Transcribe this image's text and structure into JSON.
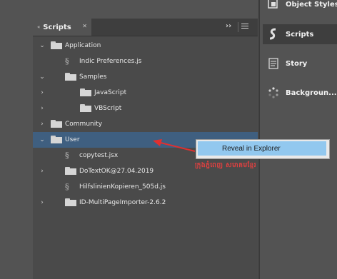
{
  "panel": {
    "tab_title": "Scripts",
    "chevron_left": "«",
    "tab_close": "✕",
    "collapse_icon": "››"
  },
  "tree": [
    {
      "label": "Application",
      "type": "folder",
      "expanded": true
    },
    {
      "label": "Indic Preferences.js",
      "type": "script"
    },
    {
      "label": "Samples",
      "type": "folder",
      "expanded": true
    },
    {
      "label": "JavaScript",
      "type": "folder",
      "expanded": false
    },
    {
      "label": "VBScript",
      "type": "folder",
      "expanded": false
    },
    {
      "label": "Community",
      "type": "folder",
      "expanded": false
    },
    {
      "label": "User",
      "type": "folder",
      "expanded": true,
      "selected": true
    },
    {
      "label": "copytest.jsx",
      "type": "script"
    },
    {
      "label": "DoTextOK@27.04.2019",
      "type": "folder",
      "expanded": false
    },
    {
      "label": "HilfslinienKopieren_505d.js",
      "type": "script"
    },
    {
      "label": "ID-MultiPageImporter-2.6.2",
      "type": "folder",
      "expanded": false
    }
  ],
  "sidebar": {
    "items": [
      {
        "label": "Object Styles",
        "icon": "object-styles-icon"
      },
      {
        "label": "Scripts",
        "icon": "scripts-icon",
        "active": true
      },
      {
        "label": "Story",
        "icon": "story-icon"
      },
      {
        "label": "Backgroun...",
        "icon": "background-tasks-icon"
      }
    ]
  },
  "context_menu": {
    "item": "Reveal in Explorer"
  },
  "annotation": {
    "text": "ក្រុងភ្នំពេញ សមាគមខ្មែរ",
    "color": "#e04040"
  },
  "colors": {
    "selection": "#3f5f80",
    "menu_highlight": "#92c8ef",
    "arrow": "#e03030"
  }
}
